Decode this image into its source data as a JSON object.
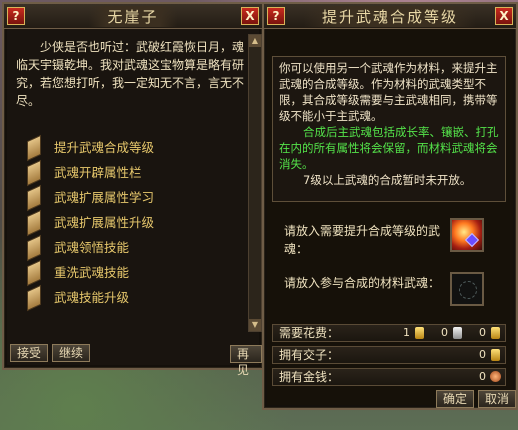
{
  "left_panel": {
    "title": "无崖子",
    "help_label": "?",
    "close_label": "X",
    "intro": "少侠是否也听过：武破红霞恢日月，魂临天宇镊乾坤。我对武魂这宝物算是略有研究，若您想打听，我一定知无不言，言无不尽。",
    "menu": [
      {
        "label": "提升武魂合成等级"
      },
      {
        "label": "武魂开辟属性栏"
      },
      {
        "label": "武魂扩展属性学习"
      },
      {
        "label": "武魂扩展属性升级"
      },
      {
        "label": "武魂领悟技能"
      },
      {
        "label": "重洗武魂技能"
      },
      {
        "label": "武魂技能升级"
      }
    ],
    "scroll_up": "▲",
    "scroll_down": "▼",
    "accept_label": "接受",
    "continue_label": "继续",
    "leave_label": "再见"
  },
  "right_panel": {
    "title": "提升武魂合成等级",
    "help_label": "?",
    "close_label": "X",
    "description": "你可以使用另一个武魂作为材料，来提升主武魂的合成等级。作为材料的武魂类型不限，其合成等级需要与主武魂相同，携带等级不能小于主武魂。",
    "description_green": "合成后主武魂包括成长率、镶嵌、打孔在内的所有属性将会保留，而材料武魂将会消失。",
    "description_note": "7级以上武魂的合成暂时未开放。",
    "main_slot_label": "请放入需要提升合成等级的武魂：",
    "material_slot_label": "请放入参与合成的材料武魂：",
    "cost": {
      "label": "需要花费：",
      "gold": "1",
      "silver": "0",
      "copper": "0"
    },
    "jiaozi": {
      "label": "拥有交子：",
      "value": "0"
    },
    "money": {
      "label": "拥有金钱：",
      "value": "0"
    },
    "confirm_label": "确定",
    "cancel_label": "取消"
  }
}
